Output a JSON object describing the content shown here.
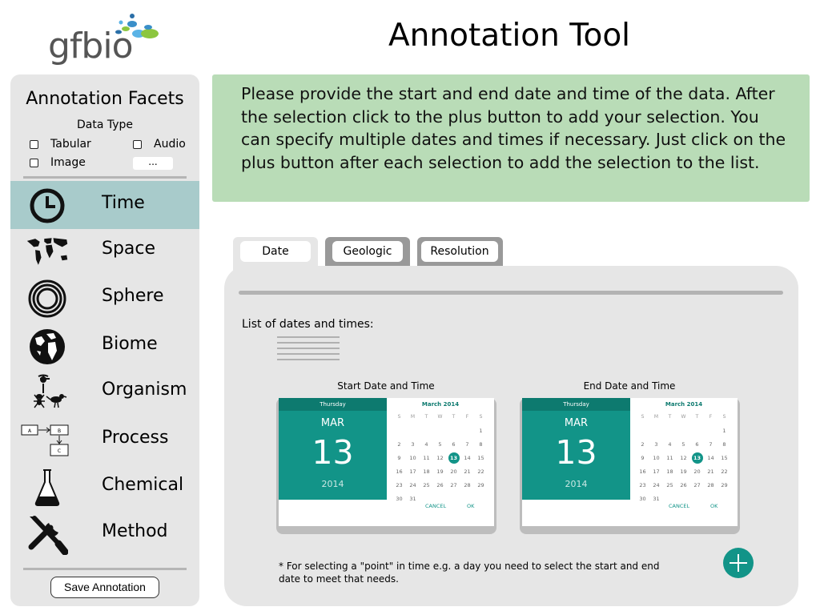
{
  "header": {
    "logo_text": "gfbio",
    "title": "Annotation Tool"
  },
  "sidebar": {
    "title": "Annotation Facets",
    "data_type_title": "Data Type",
    "data_types": [
      {
        "label": "Tabular",
        "checked": false
      },
      {
        "label": "Audio",
        "checked": false
      },
      {
        "label": "Image",
        "checked": false
      }
    ],
    "more_label": "...",
    "items": [
      {
        "label": "Time",
        "icon": "clock-icon",
        "active": true
      },
      {
        "label": "Space",
        "icon": "world-map-icon",
        "active": false
      },
      {
        "label": "Sphere",
        "icon": "concentric-rings-icon",
        "active": false
      },
      {
        "label": "Biome",
        "icon": "globe-icon",
        "active": false
      },
      {
        "label": "Organism",
        "icon": "organism-icon",
        "active": false
      },
      {
        "label": "Process",
        "icon": "process-flow-icon",
        "active": false
      },
      {
        "label": "Chemical",
        "icon": "flask-icon",
        "active": false
      },
      {
        "label": "Method",
        "icon": "wrench-screwdriver-icon",
        "active": false
      }
    ],
    "save_label": "Save Annotation",
    "active_color": "#a8cbcb"
  },
  "instruction": {
    "text": "Please provide the start and end date and time of the data. After the selection click to the plus button to add your selection. You can specify multiple dates and times if necessary. Just click on the plus button after each selection to add the selection to the list."
  },
  "tabs": [
    {
      "label": "Date",
      "active": true
    },
    {
      "label": "Geologic",
      "active": false
    },
    {
      "label": "Resolution",
      "active": false
    }
  ],
  "panel": {
    "list_label": "List of dates and times:",
    "pickers": [
      {
        "title": "Start Date and Time",
        "day_of_week": "Thursday",
        "month_short": "MAR",
        "day": "13",
        "year": "2014",
        "month_year": "March 2014",
        "weekdays": [
          "S",
          "M",
          "T",
          "W",
          "T",
          "F",
          "S"
        ],
        "selected_day": "13",
        "cancel_label": "CANCEL",
        "ok_label": "OK"
      },
      {
        "title": "End Date and Time",
        "day_of_week": "Thursday",
        "month_short": "MAR",
        "day": "13",
        "year": "2014",
        "month_year": "March 2014",
        "weekdays": [
          "S",
          "M",
          "T",
          "W",
          "T",
          "F",
          "S"
        ],
        "selected_day": "13",
        "cancel_label": "CANCEL",
        "ok_label": "OK"
      }
    ],
    "calendar_days": [
      "",
      "",
      "",
      "",
      "",
      "",
      "1",
      "2",
      "3",
      "4",
      "5",
      "6",
      "7",
      "8",
      "9",
      "10",
      "11",
      "12",
      "13",
      "14",
      "15",
      "16",
      "17",
      "18",
      "19",
      "20",
      "21",
      "22",
      "23",
      "24",
      "25",
      "26",
      "27",
      "28",
      "29",
      "30",
      "31"
    ],
    "footnote": "* For selecting a \"point\" in time e.g. a day you need to select the start and end date to meet that needs.",
    "accent_color": "#129488"
  }
}
